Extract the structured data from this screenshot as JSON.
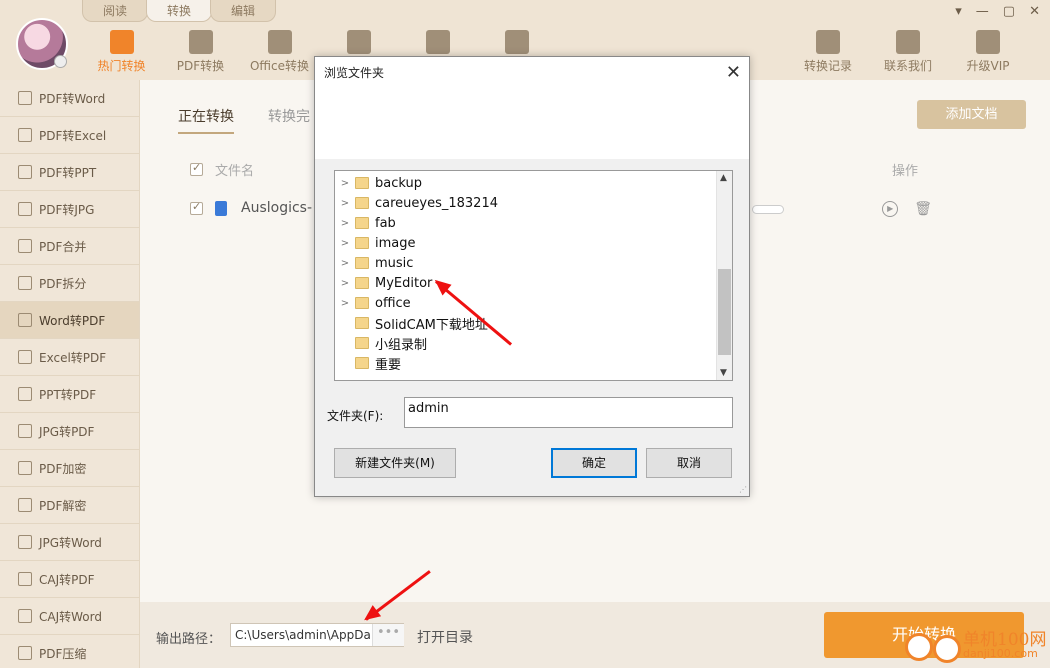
{
  "top_tabs": [
    "阅读",
    "转换",
    "编辑"
  ],
  "nav": [
    {
      "label": "热门转换",
      "icon": "star-icon"
    },
    {
      "label": "PDF转换",
      "icon": "pdf-icon"
    },
    {
      "label": "Office转换",
      "icon": "office-icon"
    },
    {
      "label": "",
      "icon": "image-icon"
    },
    {
      "label": "",
      "icon": "briefcase-icon"
    },
    {
      "label": "",
      "icon": "cabinet-icon"
    }
  ],
  "nav_right": [
    {
      "label": "转换记录",
      "icon": "history-icon"
    },
    {
      "label": "联系我们",
      "icon": "support-icon"
    },
    {
      "label": "升级VIP",
      "icon": "crown-icon"
    }
  ],
  "window_controls": [
    "▾",
    "—",
    "▢",
    "✕"
  ],
  "sidebar": [
    "PDF转Word",
    "PDF转Excel",
    "PDF转PPT",
    "PDF转JPG",
    "PDF合并",
    "PDF拆分",
    "Word转PDF",
    "Excel转PDF",
    "PPT转PDF",
    "JPG转PDF",
    "PDF加密",
    "PDF解密",
    "JPG转Word",
    "CAJ转PDF",
    "CAJ转Word",
    "PDF压缩"
  ],
  "main": {
    "tabs": [
      "正在转换",
      "转换完"
    ],
    "add_button": "添加文档",
    "col_filename": "文件名",
    "col_ops": "操作",
    "row_filename": "Auslogics-"
  },
  "bottom": {
    "output_label": "输出路径：",
    "output_path": "C:\\Users\\admin\\AppDa",
    "dots": "•••",
    "open_dir": "打开目录",
    "start_button": "开始转换"
  },
  "watermark": {
    "text": "单机100网",
    "url": "danji100.com"
  },
  "dialog": {
    "title": "浏览文件夹",
    "close": "✕",
    "folders": [
      {
        "name": "backup",
        "expandable": true
      },
      {
        "name": "careueyes_183214",
        "expandable": true
      },
      {
        "name": "fab",
        "expandable": true
      },
      {
        "name": "image",
        "expandable": true
      },
      {
        "name": "music",
        "expandable": true
      },
      {
        "name": "MyEditor",
        "expandable": true
      },
      {
        "name": "office",
        "expandable": true
      },
      {
        "name": "SolidCAM下载地址",
        "expandable": false
      },
      {
        "name": "小组录制",
        "expandable": false
      },
      {
        "name": "重要",
        "expandable": false
      }
    ],
    "folder_label": "文件夹(F):",
    "folder_value": "admin",
    "new_folder": "新建文件夹(M)",
    "ok": "确定",
    "cancel": "取消"
  }
}
